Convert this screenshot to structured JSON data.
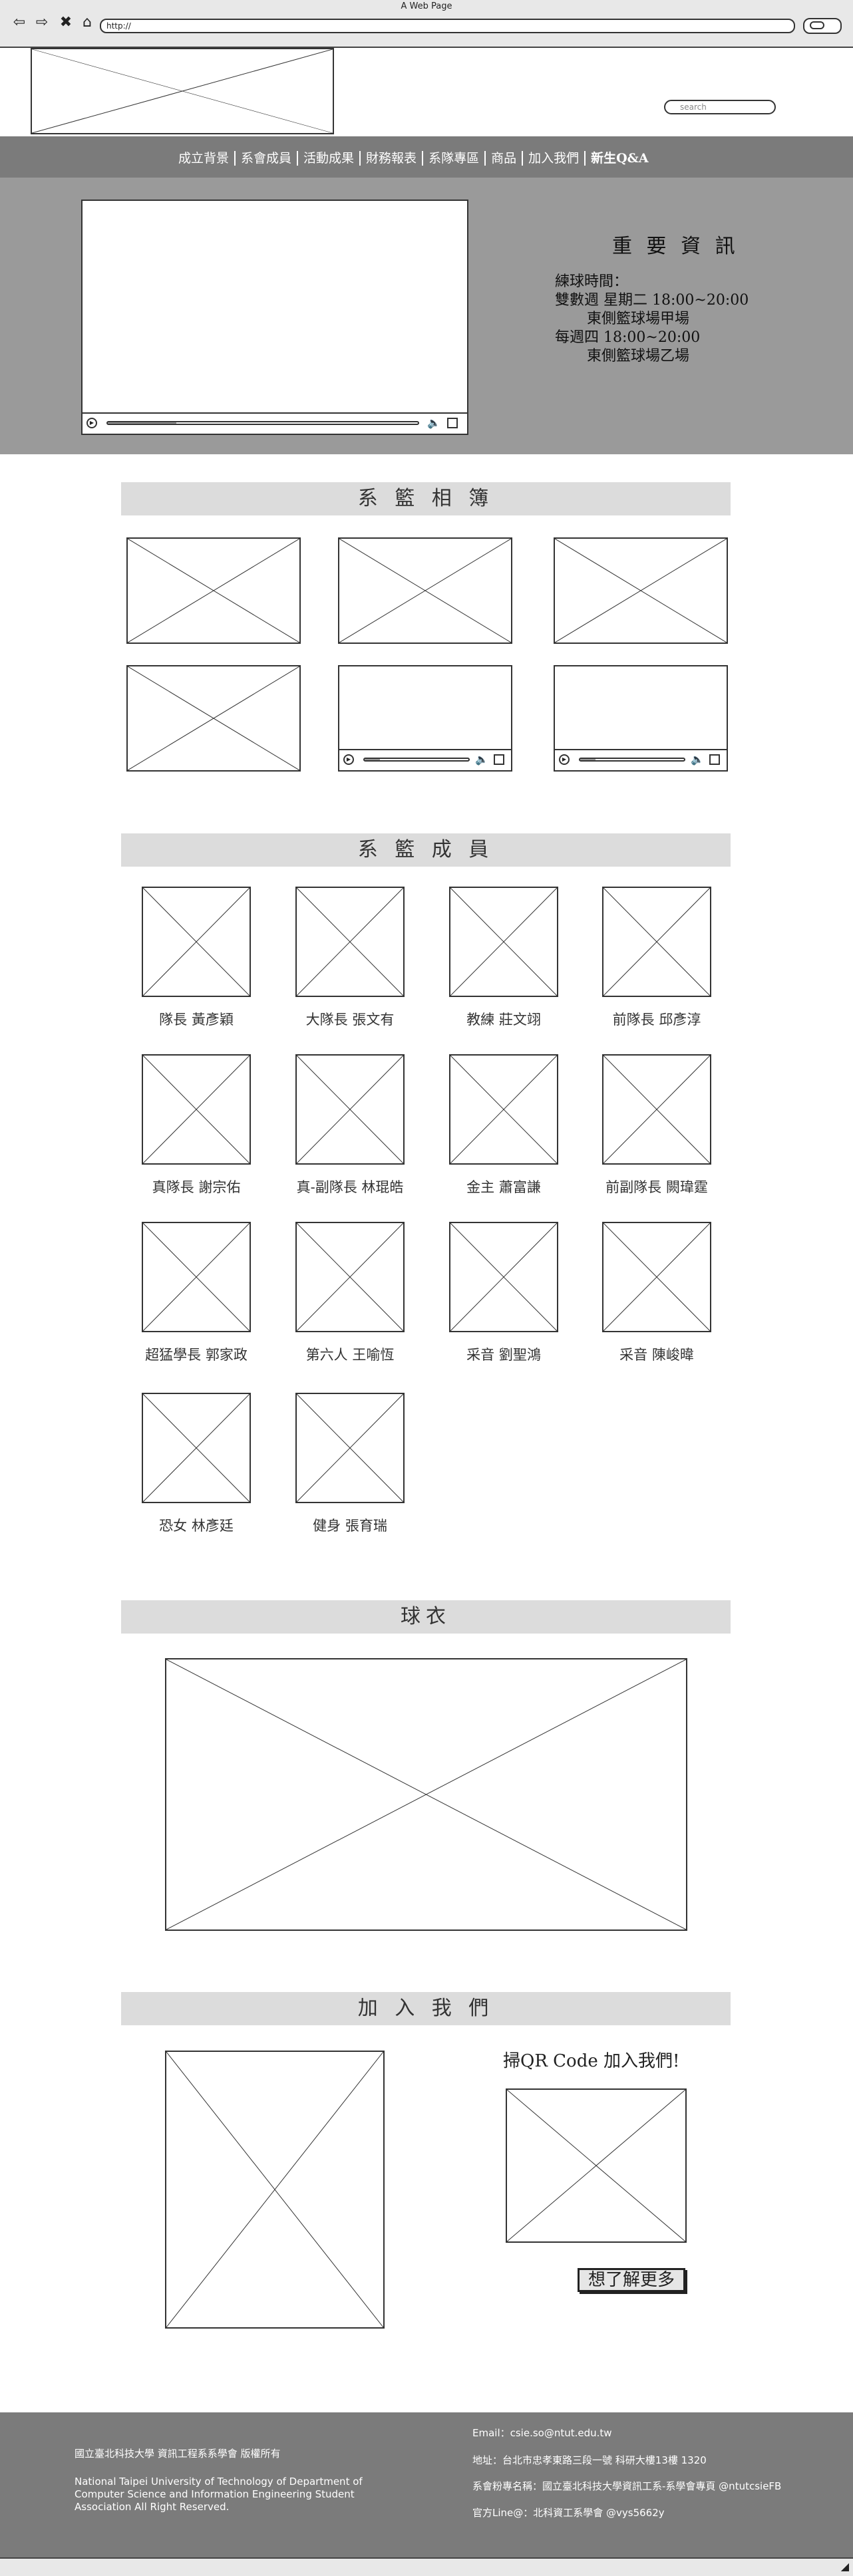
{
  "browser": {
    "window_title": "A Web Page",
    "url": "http://",
    "back_icon": "back-arrow-icon",
    "forward_icon": "forward-arrow-icon",
    "stop_icon": "close-icon",
    "refresh_icon": "refresh-icon"
  },
  "header": {
    "logo_icon": "image-placeholder-icon",
    "search_placeholder": "search"
  },
  "nav": {
    "items": [
      "成立背景",
      "系會成員",
      "活動成果",
      "財務報表",
      "系隊專區",
      "商品",
      "加入我們",
      "新生Q&A"
    ]
  },
  "hero": {
    "video_icon": "video-player-icon",
    "info_title": "重 要 資 訊",
    "info_lines": [
      "練球時間：",
      "雙數週 星期二 18:00~20:00",
      "東側籃球場甲場",
      "每週四 18:00~20:00",
      "東側籃球場乙場"
    ]
  },
  "album": {
    "title": "系 籃 相 簿",
    "items": [
      "image",
      "image",
      "image",
      "image",
      "video",
      "video"
    ]
  },
  "members": {
    "title": "系 籃 成 員",
    "list": [
      "隊長 黃彥穎",
      "大隊長 張文有",
      "教練 莊文翊",
      "前隊長 邱彥淳",
      "真隊長 謝宗佑",
      "真-副隊長 林琨皓",
      "金主 蕭富謙",
      "前副隊長 闕瑋霆",
      "超猛學長 郭家政",
      "第六人 王喻恆",
      "采音 劉聖鴻",
      "采音 陳峻暐",
      "恐女 林彥廷",
      "健身 張育瑞"
    ]
  },
  "jersey": {
    "title": "球衣"
  },
  "join": {
    "title": "加 入 我 們",
    "qr_caption": "掃QR Code 加入我們!",
    "more_button": "想了解更多"
  },
  "footer": {
    "copyright_zh": "國立臺北科技大學 資訊工程系系學會 版權所有",
    "copyright_en": "National Taipei University of Technology of Department of Computer Science and Information Engineering Student Association All Right Reserved.",
    "email": "Email：csie.so@ntut.edu.tw",
    "address": "地址：台北市忠孝東路三段一號 科研大樓13樓 1320",
    "fanpage": "系會粉專名稱：國立臺北科技大學資訊工系-系學會專頁 @ntutcsieFB",
    "line": "官方Line@：北科資工系學會 @vys5662y"
  }
}
